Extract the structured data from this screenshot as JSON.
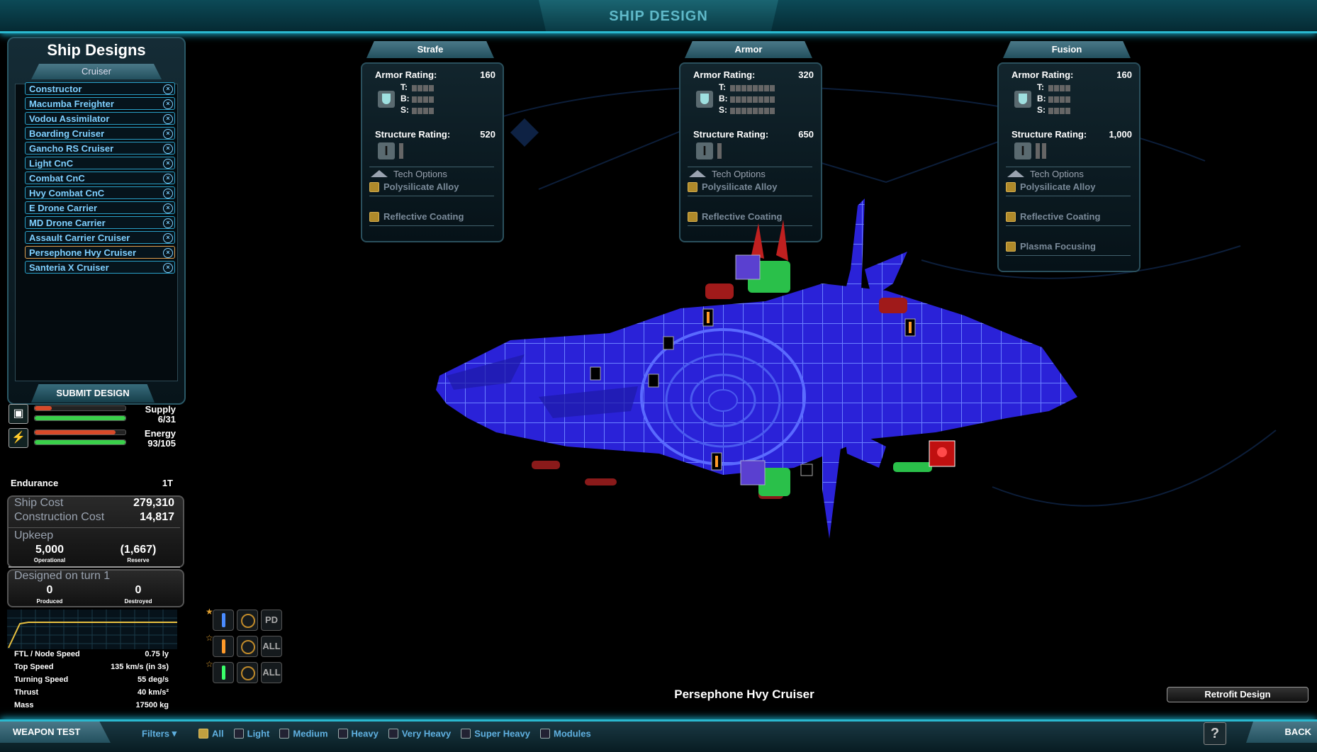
{
  "header": {
    "title": "SHIP DESIGN"
  },
  "designs": {
    "title": "Ship Designs",
    "class_tab": "Cruiser",
    "items": [
      {
        "label": "Constructor"
      },
      {
        "label": "Macumba Freighter"
      },
      {
        "label": "Vodou Assimilator"
      },
      {
        "label": "Boarding Cruiser"
      },
      {
        "label": "Gancho RS Cruiser"
      },
      {
        "label": "Light CnC"
      },
      {
        "label": "Combat CnC"
      },
      {
        "label": "Hvy Combat CnC"
      },
      {
        "label": "E Drone Carrier"
      },
      {
        "label": "MD Drone Carrier"
      },
      {
        "label": "Assault Carrier Cruiser"
      },
      {
        "label": "Persephone Hvy Cruiser",
        "selected": true
      },
      {
        "label": "Santeria X Cruiser"
      }
    ],
    "submit_label": "SUBMIT DESIGN"
  },
  "resources": {
    "supply": {
      "label": "Supply",
      "value": "6/31",
      "fraction": 0.19
    },
    "energy": {
      "label": "Energy",
      "value": "93/105",
      "fraction": 0.89
    }
  },
  "stats": {
    "endurance_label": "Endurance",
    "endurance_value": "1T",
    "ship_cost_label": "Ship Cost",
    "ship_cost_value": "279,310",
    "construction_cost_label": "Construction Cost",
    "construction_cost_value": "14,817",
    "upkeep_label": "Upkeep",
    "operational_value": "5,000",
    "operational_label": "Operational",
    "reserve_value": "(1,667)",
    "reserve_label": "Reserve",
    "designed_label": "Designed on turn 1",
    "produced_value": "0",
    "produced_label": "Produced",
    "destroyed_value": "0",
    "destroyed_label": "Destroyed"
  },
  "specs": [
    {
      "label": "FTL / Node Speed",
      "value": "0.75 ly"
    },
    {
      "label": "Top Speed",
      "value": "135 km/s (in 3s)"
    },
    {
      "label": "Turning Speed",
      "value": "55 deg/s"
    },
    {
      "label": "Thrust",
      "value": "40 km/s²"
    },
    {
      "label": "Mass",
      "value": "17500 kg"
    }
  ],
  "panels": [
    {
      "tab": "Strafe",
      "armor_label": "Armor Rating:",
      "armor_value": "160",
      "t": "T:",
      "b": "B:",
      "s": "S:",
      "pips": 4,
      "structure_label": "Structure Rating:",
      "structure_value": "520",
      "gpips": 1,
      "tech_header": "Tech Options",
      "techs": [
        "Polysilicate Alloy",
        "Reflective Coating"
      ]
    },
    {
      "tab": "Armor",
      "armor_label": "Armor Rating:",
      "armor_value": "320",
      "t": "T:",
      "b": "B:",
      "s": "S:",
      "pips": 8,
      "structure_label": "Structure Rating:",
      "structure_value": "650",
      "gpips": 1,
      "tech_header": "Tech Options",
      "techs": [
        "Polysilicate Alloy",
        "Reflective Coating"
      ]
    },
    {
      "tab": "Fusion",
      "armor_label": "Armor Rating:",
      "armor_value": "160",
      "t": "T:",
      "b": "B:",
      "s": "S:",
      "pips": 4,
      "structure_label": "Structure Rating:",
      "structure_value": "1,000",
      "gpips": 2,
      "tech_header": "Tech Options",
      "techs": [
        "Polysilicate Alloy",
        "Reflective Coating",
        "Plasma Focusing"
      ]
    }
  ],
  "weapon_groups": [
    {
      "mode": "PD",
      "color": "#4a8cff"
    },
    {
      "mode": "ALL",
      "color": "#ff9a2a"
    },
    {
      "mode": "ALL",
      "color": "#3aff6a"
    }
  ],
  "ship_name": "Persephone Hvy Cruiser",
  "retrofit_label": "Retrofit Design",
  "bottom": {
    "weapon_test": "WEAPON TEST",
    "filters": "Filters",
    "filter_items": [
      "All",
      "Light",
      "Medium",
      "Heavy",
      "Very Heavy",
      "Super Heavy",
      "Modules"
    ],
    "help": "?",
    "back": "BACK"
  },
  "colors": {
    "accent": "#2ab8cf",
    "ship": "#2f2fe0",
    "list_text": "#7fd0ff"
  }
}
